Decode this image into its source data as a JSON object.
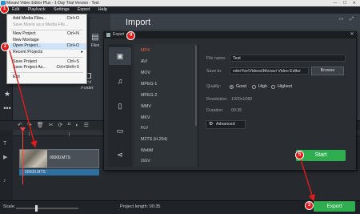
{
  "window": {
    "title": "Movavi Video Editor Plus - 1-Day Trial Version - Test"
  },
  "menubar": {
    "items": [
      "Edit",
      "Playback",
      "Settings",
      "Export",
      "Help"
    ]
  },
  "import": {
    "title": "Import",
    "add_files": "Files",
    "add_folder_line1": "Add",
    "add_folder_line2": "Folder"
  },
  "file_menu": {
    "items": [
      {
        "label": "Add Media Files...",
        "shortcut": "Ctrl+O",
        "disabled": false
      },
      {
        "label": "Save Movie as a Media File...",
        "shortcut": "",
        "disabled": true
      },
      {
        "label": "New Project",
        "shortcut": "Ctrl+N",
        "disabled": false
      },
      {
        "label": "New Montage",
        "shortcut": "",
        "disabled": false
      },
      {
        "label": "Open Project...",
        "shortcut": "Ctrl+O",
        "disabled": false
      },
      {
        "label": "Recent Projects",
        "shortcut": "",
        "disabled": false
      },
      {
        "label": "Save Project",
        "shortcut": "Ctrl+S",
        "disabled": false
      },
      {
        "label": "Save Project As...",
        "shortcut": "Ctrl+Shift+S",
        "disabled": false
      },
      {
        "label": "Exit",
        "shortcut": "",
        "disabled": false
      }
    ]
  },
  "export_dialog": {
    "title": "Export",
    "categories": [
      "video-icon",
      "music-icon",
      "devices-icon",
      "tv-icon",
      "share-icon"
    ],
    "formats": [
      "MP4",
      "AVI",
      "MOV",
      "MPEG-1",
      "MPEG-2",
      "WMV",
      "MKV",
      "FLV",
      "M2TS (H.264)",
      "WebM",
      "OGV"
    ],
    "selected_format": "MP4",
    "file_name_label": "File name:",
    "file_name_value": "Test",
    "save_to_label": "Save to:",
    "save_to_value": "vderYox\\Videos\\Movavi Video Editor",
    "browse_label": "Browse",
    "quality_label": "Quality:",
    "quality_options": [
      "Good",
      "High",
      "Highest"
    ],
    "quality_selected": "Good",
    "resolution_label": "Resolution:",
    "resolution_value": "1920x1080",
    "duration_label": "Duration:",
    "duration_value": "00:35",
    "advanced_label": "Advanced",
    "start_label": "Start"
  },
  "timeline": {
    "clip_name": "00000.MTS",
    "audio_name": "00000.MTS"
  },
  "statusbar": {
    "scale_label": "Scale:",
    "project_length": "Project length: 00:35",
    "export_label": "Export"
  },
  "badges": [
    "1",
    "2",
    "3",
    "4",
    "5"
  ],
  "colors": {
    "accent_green": "#2fae4f",
    "annotation_red": "#e21a1a",
    "selected_format": "#ff5a3c"
  }
}
